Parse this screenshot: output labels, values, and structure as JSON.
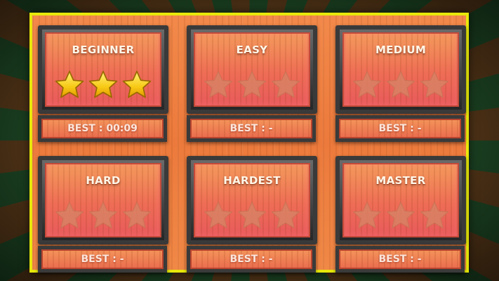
{
  "colors": {
    "board_border": "#e8e80a",
    "star_earned": "#f7c915",
    "star_empty": "#d98264"
  },
  "levels": [
    {
      "title": "BEGINNER",
      "best": "BEST : 00:09",
      "stars_earned": 3,
      "stars_total": 3
    },
    {
      "title": "EASY",
      "best": "BEST : -",
      "stars_earned": 0,
      "stars_total": 3
    },
    {
      "title": "MEDIUM",
      "best": "BEST : -",
      "stars_earned": 0,
      "stars_total": 3
    },
    {
      "title": "HARD",
      "best": "BEST : -",
      "stars_earned": 0,
      "stars_total": 3
    },
    {
      "title": "HARDEST",
      "best": "BEST : -",
      "stars_earned": 0,
      "stars_total": 3
    },
    {
      "title": "MASTER",
      "best": "BEST : -",
      "stars_earned": 0,
      "stars_total": 3
    }
  ]
}
